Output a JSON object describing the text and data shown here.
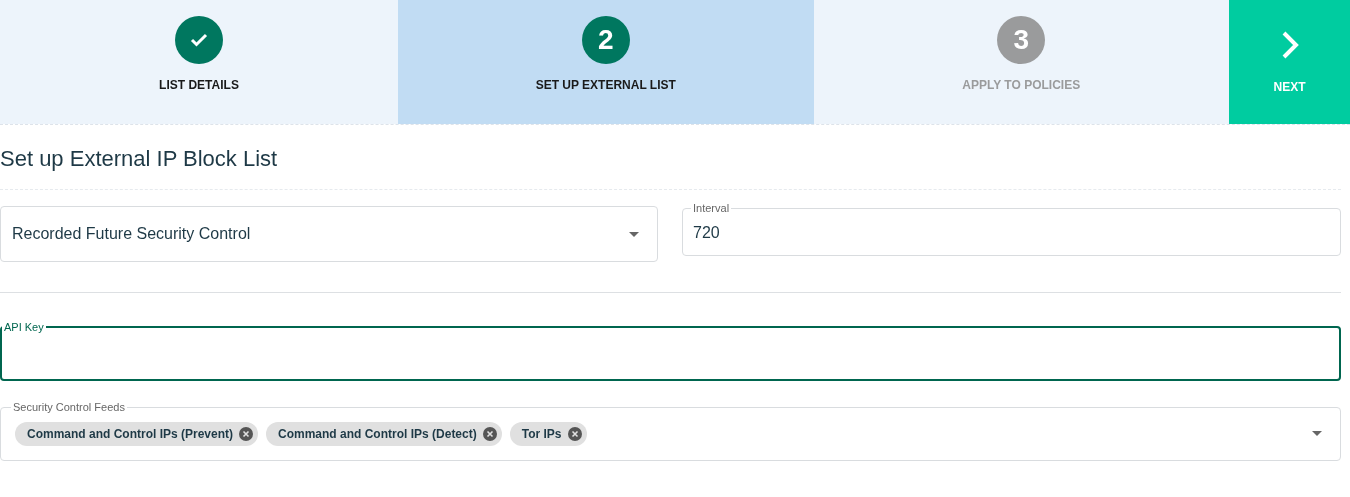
{
  "steps": [
    {
      "label": "LIST DETAILS",
      "completed": true,
      "selected": false
    },
    {
      "number": "2",
      "label": "SET UP EXTERNAL LIST",
      "completed": false,
      "selected": true
    },
    {
      "number": "3",
      "label": "APPLY TO POLICIES",
      "completed": false,
      "selected": false
    }
  ],
  "next_button": {
    "label": "NEXT"
  },
  "title": "Set up External IP Block List",
  "source_select": {
    "value": "Recorded Future Security Control"
  },
  "interval": {
    "label": "Interval",
    "value": "720"
  },
  "api_key": {
    "label": "API Key",
    "focused": true
  },
  "feeds": {
    "label": "Security Control Feeds",
    "chips": [
      "Command and Control IPs (Prevent)",
      "Command and Control IPs (Detect)",
      "Tor IPs"
    ]
  }
}
